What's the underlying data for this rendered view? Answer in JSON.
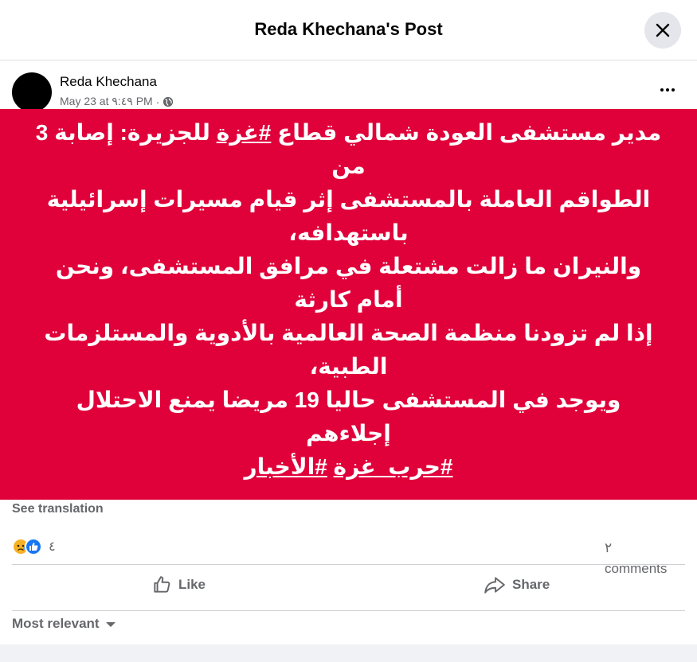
{
  "dialog": {
    "title": "Reda Khechana's Post"
  },
  "post": {
    "author": "Reda Khechana",
    "timestamp": "May 23 at ٩:٤٩ PM",
    "separator": "·",
    "privacy_icon": "globe-icon",
    "card_background": "#e0003a",
    "lines": [
      "مدير مستشفى العودة شمالي قطاع",
      "#غزة",
      "للجزيرة: إصابة 3 من",
      "الطواقم العاملة بالمستشفى إثر قيام مسيرات إسرائيلية باستهدافه،",
      "والنيران ما زالت مشتعلة في مرافق المستشفى، ونحن أمام كارثة",
      "إذا لم تزودنا منظمة الصحة العالمية بالأدوية والمستلزمات الطبية،",
      "ويوجد في المستشفى حاليا 19 مريضا يمنع الاحتلال إجلاءهم",
      "#حرب_غزة",
      "#الأخبار"
    ]
  },
  "see_translation": "See translation",
  "stats": {
    "reaction_icons": [
      "sad-icon",
      "like-icon"
    ],
    "reaction_count": "٤",
    "comments_number": "٢",
    "comments_label": "comments"
  },
  "actions": {
    "like_label": "Like",
    "share_label": "Share"
  },
  "comments_sort": {
    "label": "Most relevant"
  },
  "colors": {
    "accent": "#1877f2",
    "secondary_text": "#65676b",
    "card": "#e0003a"
  }
}
